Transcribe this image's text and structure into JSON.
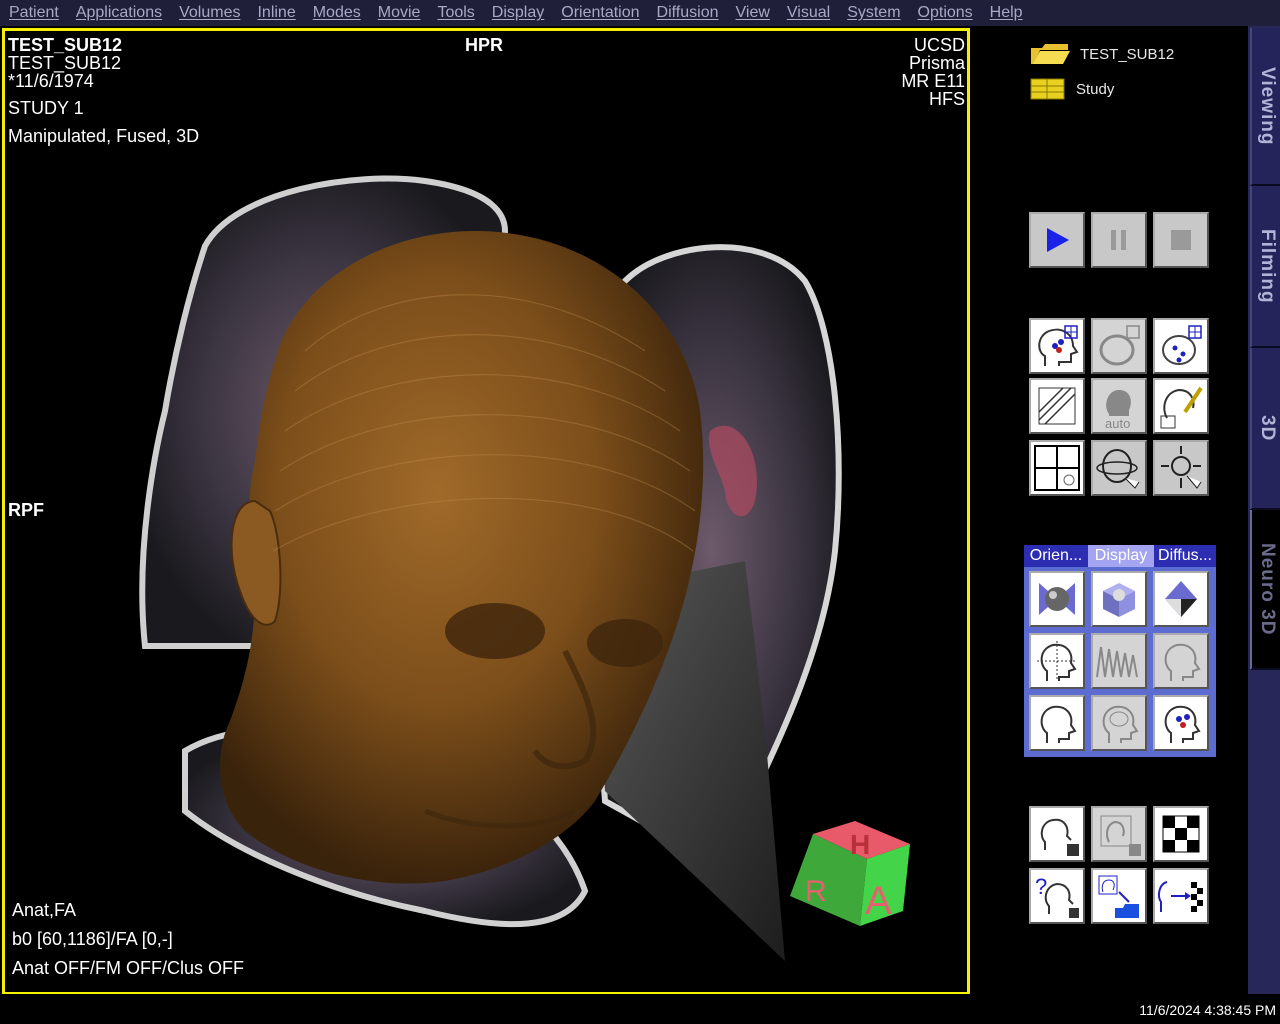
{
  "menu": [
    "Patient",
    "Applications",
    "Volumes",
    "Inline",
    "Modes",
    "Movie",
    "Tools",
    "Display",
    "Orientation",
    "Diffusion",
    "View",
    "Visual",
    "System",
    "Options",
    "Help"
  ],
  "viewer": {
    "patient_name": "TEST_SUB12",
    "patient_id": "TEST_SUB12",
    "birthdate": "*11/6/1974",
    "study": "STUDY 1",
    "image_type": "Manipulated, Fused, 3D",
    "orientation_top": "HPR",
    "orientation_left": "RPF",
    "institution": "UCSD",
    "scanner": "Prisma",
    "software": "MR E11",
    "position": "HFS",
    "overlay_line1": "Anat,FA",
    "overlay_line2": "b0 [60,1186]/FA [0,-]",
    "overlay_line3": "Anat OFF/FM OFF/Clus OFF",
    "cube_letters": {
      "top": "H",
      "left": "R",
      "front": "A"
    }
  },
  "tree": {
    "patient": "TEST_SUB12",
    "study": "Study"
  },
  "side_tabs": [
    "Viewing",
    "Filming",
    "3D",
    "Neuro 3D"
  ],
  "tool_tabs": [
    "Orien...",
    "Display",
    "Diffus..."
  ],
  "tool_tab_selected": "Display",
  "icon_labels": {
    "auto": "auto"
  },
  "status": {
    "datetime": "11/6/2024 4:38:45 PM"
  },
  "colors": {
    "viewer_border": "#f4f000",
    "menubar": "#1f1f3a",
    "tab_strip": "#24245a",
    "toolbox": "#5c6cd0",
    "play_blue": "#1a22e8"
  }
}
